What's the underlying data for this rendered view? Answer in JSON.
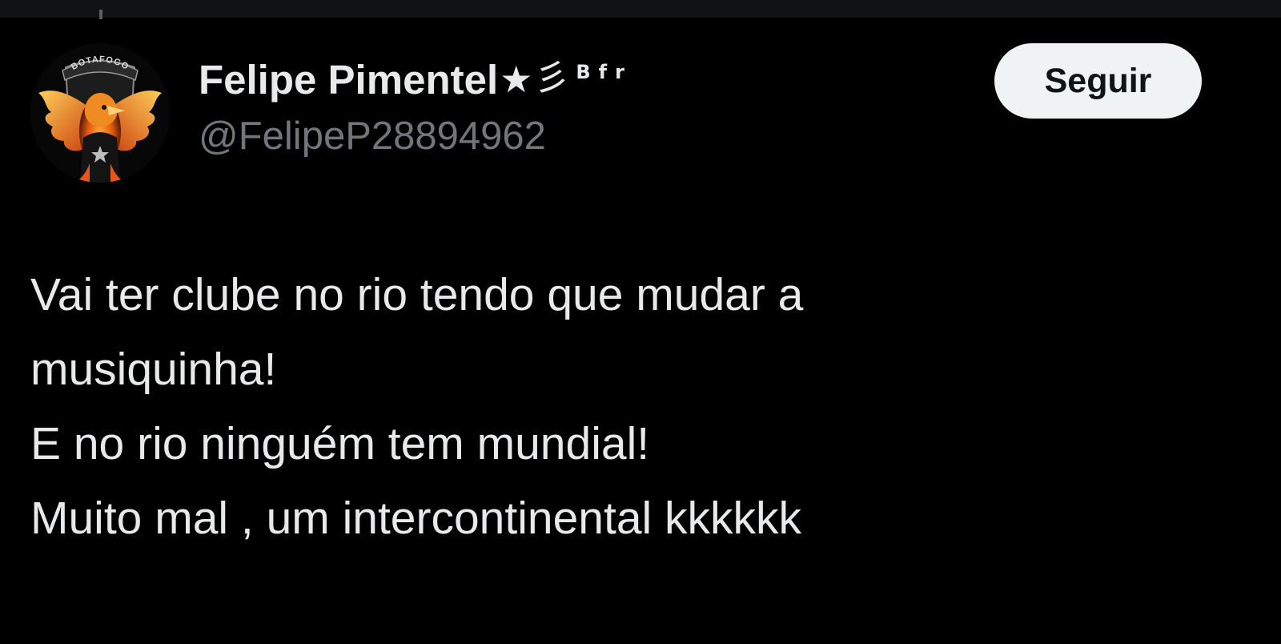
{
  "tweet": {
    "author": {
      "display_name": "Felipe Pimentel",
      "name_emoji_star": "★",
      "name_emoji_waves": "彡",
      "name_superscript": "Bfr",
      "handle": "@FelipeP28894962",
      "avatar": {
        "badge_text": "BOTAFOGO",
        "icon": "phoenix-avatar-icon"
      }
    },
    "follow_button_label": "Seguir",
    "text_lines": [
      "Vai ter clube no rio tendo que mudar a",
      "musiquinha!",
      "E no rio ninguém tem mundial!",
      "Muito mal , um intercontinental kkkkkk"
    ]
  },
  "colors": {
    "background": "#000000",
    "primary_text": "#e7e9ea",
    "secondary_text": "#71767b",
    "button_background": "#eff3f4",
    "button_text": "#0f1419"
  }
}
